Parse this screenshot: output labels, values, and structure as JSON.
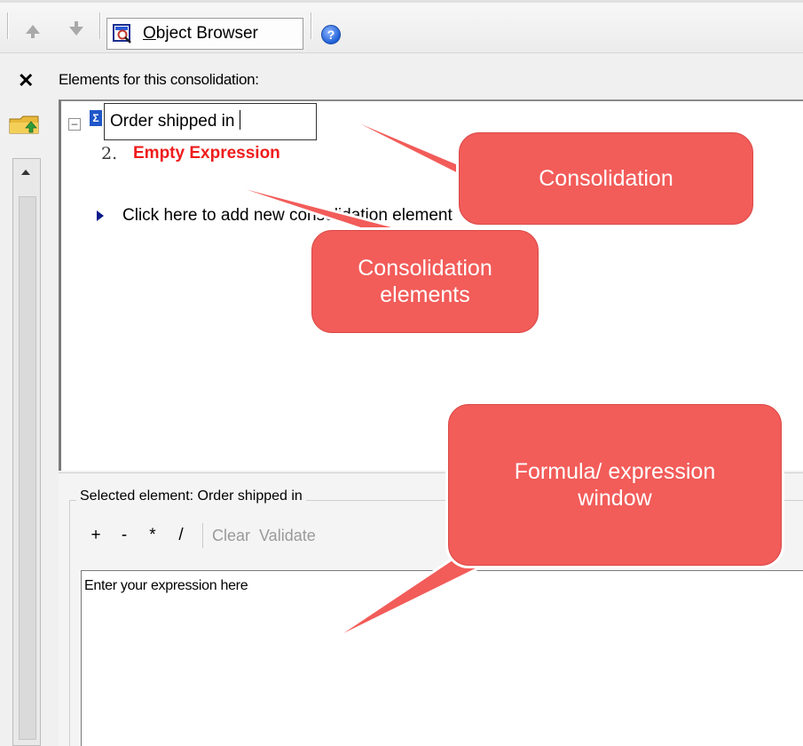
{
  "toolbar": {
    "object_browser_label_first": "O",
    "object_browser_label_rest": "bject Browser",
    "help_glyph": "?"
  },
  "left_strip": {
    "close_glyph": "✕"
  },
  "tree": {
    "header": "Elements for this consolidation:",
    "collapse_glyph": "–",
    "sigma_glyph": "Σ",
    "editing_value": "Order shipped in",
    "item2_number": "2.",
    "item2_label": "Empty Expression",
    "add_row_text": "Click here to add new consolidation element"
  },
  "selected": {
    "label": "Selected element: Order shipped in",
    "ops": [
      "+",
      "-",
      "*",
      "/"
    ],
    "clear": "Clear",
    "validate": "Validate",
    "expression_placeholder": "Enter your expression here"
  },
  "callouts": {
    "consolidation": "Consolidation",
    "elements_line1": "Consolidation",
    "elements_line2": "elements",
    "formula_line1": "Formula/ expression",
    "formula_line2": "window"
  },
  "colors": {
    "callout_fill": "#f25c59",
    "empty_expression": "#ef1c1c",
    "sigma_icon": "#1f56c9"
  },
  "icons": [
    "arrow-up-icon",
    "arrow-down-icon",
    "object-browser-icon",
    "help-icon",
    "close-icon",
    "folder-up-icon",
    "sigma-icon",
    "collapse-icon",
    "add-row-arrow-icon"
  ]
}
